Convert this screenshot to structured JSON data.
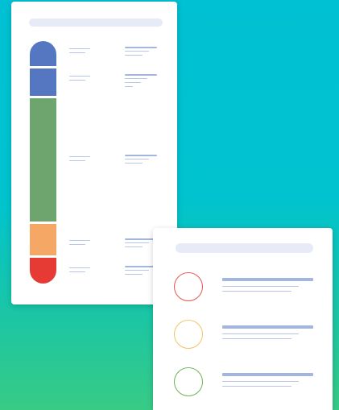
{
  "palette": {
    "background_top": "#00c0d3",
    "background_bottom": "#38cb85",
    "card": "#ffffff",
    "placeholder_bar": "#e6ebf7",
    "text_line_primary": "#a2b6df",
    "text_line_secondary": "#b7c6e7"
  },
  "stack_card": {
    "segments": [
      {
        "fraction": 0.107,
        "color": "#5577c1"
      },
      {
        "fraction": 0.117,
        "color": "#5577c1"
      },
      {
        "fraction": 0.531,
        "color": "#6ea56e"
      },
      {
        "fraction": 0.135,
        "color": "#f5a866"
      },
      {
        "fraction": 0.11,
        "color": "#e63a34"
      }
    ]
  },
  "legend_card": {
    "items": [
      {
        "ring_color": "#e8574c"
      },
      {
        "ring_color": "#f3c563"
      },
      {
        "ring_color": "#6fb356"
      }
    ]
  }
}
